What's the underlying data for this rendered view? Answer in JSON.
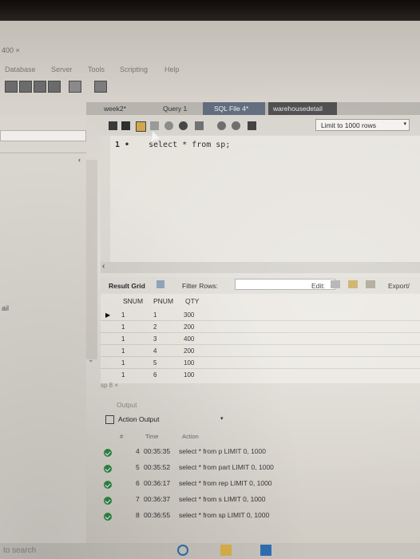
{
  "window": {
    "title_fragment": "400 ×"
  },
  "menu": {
    "items": [
      "Database",
      "Server",
      "Tools",
      "Scripting",
      "Help"
    ]
  },
  "tabs": [
    {
      "label": "week2*"
    },
    {
      "label": "Query 1"
    },
    {
      "label": "SQL File 4*"
    },
    {
      "label": "warehousedetail"
    }
  ],
  "editor": {
    "limit_label": "Limit to 1000 rows",
    "line_number": "1",
    "code_line": "select * from sp;"
  },
  "results": {
    "grid_label": "Result Grid",
    "filter_label": "Filter Rows:",
    "edit_label": "Edit:",
    "export_label": "Export/",
    "columns": [
      "SNUM",
      "PNUM",
      "QTY"
    ],
    "rows": [
      [
        "1",
        "1",
        "300"
      ],
      [
        "1",
        "2",
        "200"
      ],
      [
        "1",
        "3",
        "400"
      ],
      [
        "1",
        "4",
        "200"
      ],
      [
        "1",
        "5",
        "100"
      ],
      [
        "1",
        "6",
        "100"
      ]
    ],
    "result_tab": "sp 8 ×"
  },
  "output": {
    "title": "Output",
    "selector_label": "Action Output",
    "col_num": "#",
    "col_time": "Time",
    "col_action": "Action",
    "rows": [
      {
        "num": "4",
        "time": "00:35:35",
        "action": "select * from p LIMIT 0, 1000"
      },
      {
        "num": "5",
        "time": "00:35:52",
        "action": "select * from part LIMIT 0, 1000"
      },
      {
        "num": "6",
        "time": "00:36:17",
        "action": "select * from rep LIMIT 0, 1000"
      },
      {
        "num": "7",
        "time": "00:36:37",
        "action": "select * from s LIMIT 0, 1000"
      },
      {
        "num": "8",
        "time": "00:36:55",
        "action": "select * from sp LIMIT 0, 1000"
      }
    ]
  },
  "side": {
    "label": "ail"
  },
  "taskbar": {
    "search_placeholder": "to search"
  },
  "colors": {
    "accent_tab": "#5f6b7d",
    "ok_green": "#2f8a45"
  }
}
